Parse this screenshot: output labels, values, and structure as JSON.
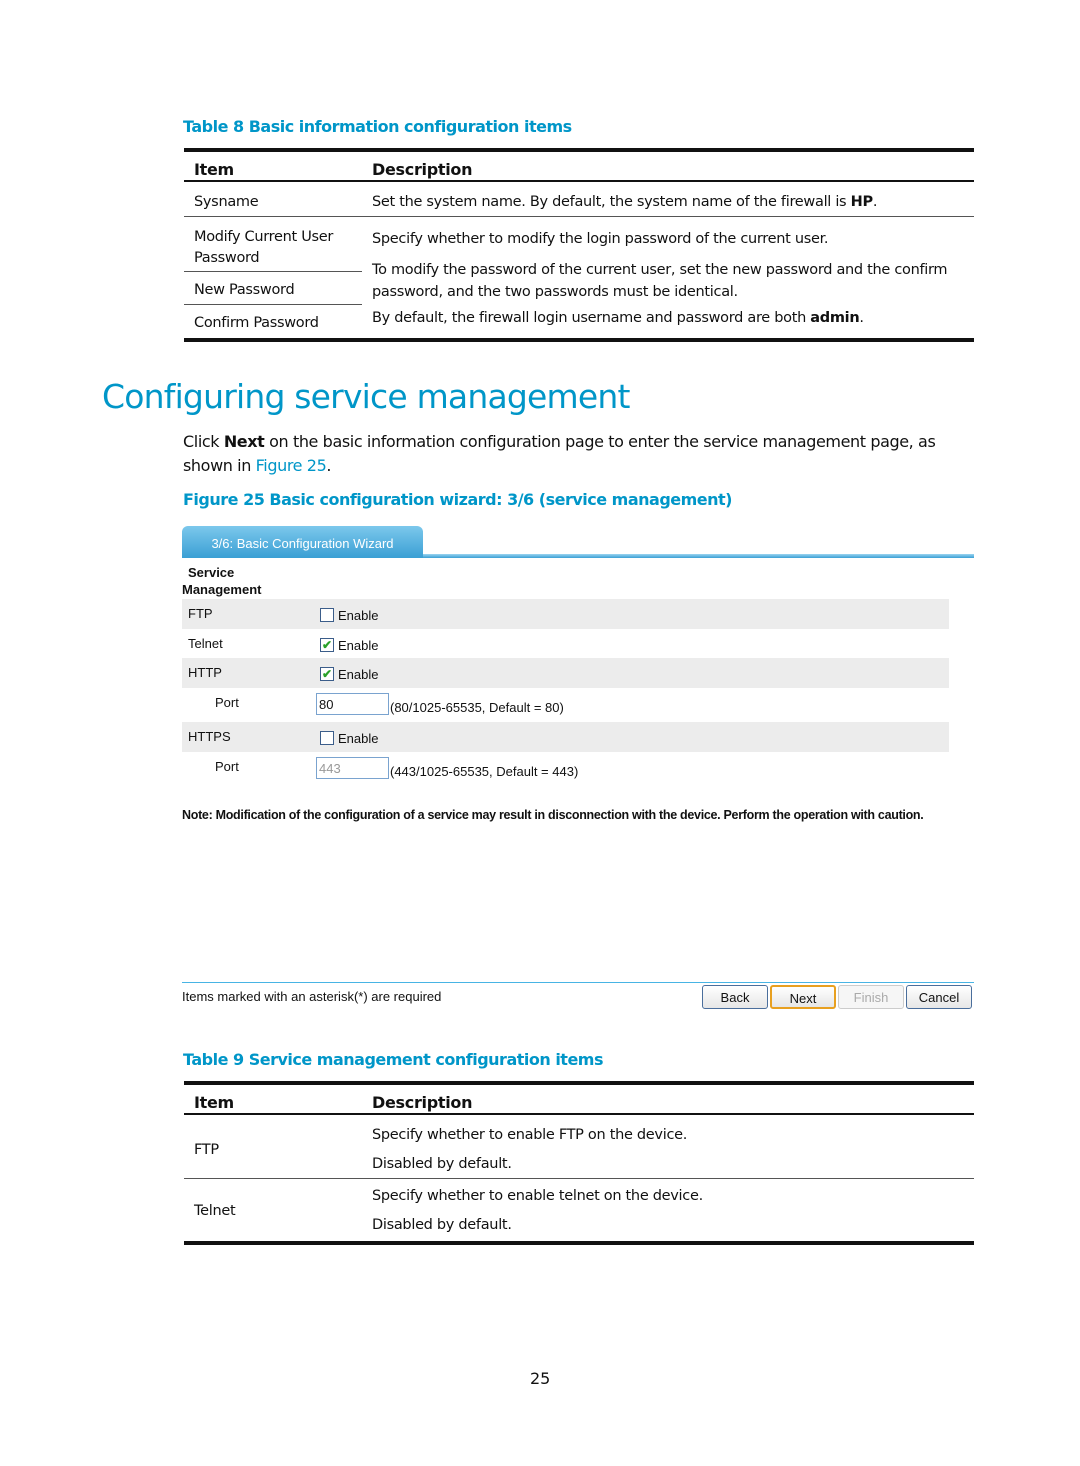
{
  "table8": {
    "caption": "Table 8 Basic information configuration items",
    "headers": [
      "Item",
      "Description"
    ],
    "rows": [
      {
        "item": "Sysname",
        "desc_prefix": "Set the system name. By default, the system name of the firewall is ",
        "desc_bold": "HP",
        "desc_suffix": "."
      },
      {
        "item": "Modify Current User Password"
      },
      {
        "item": "New Password"
      },
      {
        "item": "Confirm Password"
      }
    ],
    "merged_desc": {
      "line1": "Specify whether to modify the login password of the current user.",
      "line2": "To modify the password of the current user, set the new password and the confirm password, and the two passwords must be identical.",
      "line3_prefix": "By default, the firewall login username and password are both ",
      "line3_bold": "admin",
      "line3_suffix": "."
    }
  },
  "section": {
    "heading": "Configuring service management",
    "para_prefix": "Click ",
    "para_bold": "Next",
    "para_middle": " on the basic information configuration page to enter the service management page, as shown in ",
    "para_link": "Figure 25",
    "para_suffix": "."
  },
  "figure": {
    "caption": "Figure 25 Basic configuration wizard: 3/6 (service management)",
    "tab_title": "3/6: Basic Configuration Wizard",
    "section_title_line1": "Service",
    "section_title_line2": "Management",
    "rows": [
      {
        "label": "FTP",
        "type": "checkbox",
        "checked": false,
        "check_label": "Enable"
      },
      {
        "label": "Telnet",
        "type": "checkbox",
        "checked": true,
        "check_label": "Enable"
      },
      {
        "label": "HTTP",
        "type": "checkbox",
        "checked": true,
        "check_label": "Enable"
      },
      {
        "label": "Port",
        "type": "input",
        "value": "80",
        "disabled": false,
        "hint": "(80/1025-65535, Default = 80)"
      },
      {
        "label": "HTTPS",
        "type": "checkbox",
        "checked": false,
        "check_label": "Enable"
      },
      {
        "label": "Port",
        "type": "input",
        "value": "443",
        "disabled": true,
        "hint": "(443/1025-65535, Default = 443)"
      }
    ],
    "note": "Note: Modification of the configuration of a service may result in disconnection with the device. Perform the operation with caution.",
    "required_text": "Items marked with an asterisk(*) are required",
    "buttons": {
      "back": "Back",
      "next": "Next",
      "finish": "Finish",
      "cancel": "Cancel"
    },
    "check_glyph": "✔"
  },
  "table9": {
    "caption": "Table 9 Service management configuration items",
    "headers": [
      "Item",
      "Description"
    ],
    "rows": [
      {
        "item": "FTP",
        "desc1": "Specify whether to enable FTP on the device.",
        "desc2": "Disabled by default."
      },
      {
        "item": "Telnet",
        "desc1": "Specify whether to enable telnet on the device.",
        "desc2": "Disabled by default."
      }
    ]
  },
  "page_number": "25"
}
